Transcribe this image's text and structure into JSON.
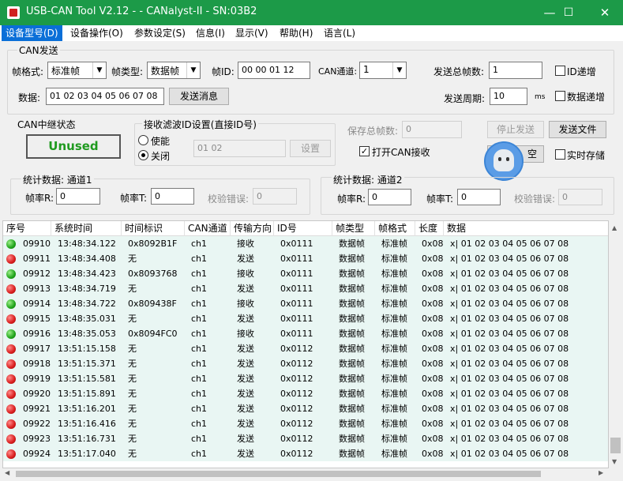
{
  "window": {
    "title": "USB-CAN Tool V2.12 -  - CANalyst-II - SN:03B2",
    "min_glyph": "—",
    "max_glyph": "☐",
    "close_glyph": "✕"
  },
  "menu": [
    "设备型号(D)",
    "设备操作(O)",
    "参数设定(S)",
    "信息(I)",
    "显示(V)",
    "帮助(H)",
    "语言(L)"
  ],
  "can_send": {
    "group_label": "CAN发送",
    "frame_format_label": "帧格式:",
    "frame_format_value": "标准帧",
    "frame_type_label": "帧类型:",
    "frame_type_value": "数据帧",
    "frame_id_label": "帧ID:",
    "frame_id_value": "00 00 01 12",
    "channel_label": "CAN通道:",
    "channel_value": "1",
    "total_frames_label": "发送总帧数:",
    "total_frames_value": "1",
    "id_increment_label": "ID递增",
    "data_label": "数据:",
    "data_value": "01 02 03 04 05 06 07 08",
    "send_button": "发送消息",
    "period_label": "发送周期:",
    "period_value": "10",
    "period_unit": "ms",
    "data_increment_label": "数据递增"
  },
  "relay": {
    "group_label": "CAN中继状态",
    "status": "Unused"
  },
  "filter": {
    "group_label": "接收滤波ID设置(直接ID号)",
    "enable_label": "使能",
    "disable_label": "关闭",
    "value": "01 02",
    "set_button": "设置"
  },
  "save": {
    "saved_frames_label": "保存总帧数:",
    "saved_frames_value": "0",
    "stop_send_button": "停止发送",
    "send_file_button": "发送文件",
    "open_receive_label": "打开CAN接收",
    "clear_button_partial": "空",
    "realtime_save_label": "实时存储"
  },
  "stats1": {
    "group_label": "统计数据: 通道1",
    "rate_r_label": "帧率R:",
    "rate_r_value": "0",
    "rate_t_label": "帧率T:",
    "rate_t_value": "0",
    "check_error_label": "校验错误:",
    "check_error_value": "0"
  },
  "stats2": {
    "group_label": "统计数据: 通道2",
    "rate_r_label": "帧率R:",
    "rate_r_value": "0",
    "rate_t_label": "帧率T:",
    "rate_t_value": "0",
    "check_error_label": "校验错误:",
    "check_error_value": "0"
  },
  "table": {
    "columns": [
      "序号",
      "系统时间",
      "时间标识",
      "CAN通道",
      "传输方向",
      "ID号",
      "帧类型",
      "帧格式",
      "长度",
      "数据"
    ],
    "rows": [
      {
        "status": "green",
        "seq": "09910",
        "sys_time": "13:48:34.122",
        "time_id": "0x8092B1F",
        "channel": "ch1",
        "direction": "接收",
        "id": "0x0111",
        "frame_type": "数据帧",
        "frame_format": "标准帧",
        "length": "0x08",
        "data": "x| 01 02 03 04 05 06 07 08"
      },
      {
        "status": "red",
        "seq": "09911",
        "sys_time": "13:48:34.408",
        "time_id": "无",
        "channel": "ch1",
        "direction": "发送",
        "id": "0x0111",
        "frame_type": "数据帧",
        "frame_format": "标准帧",
        "length": "0x08",
        "data": "x| 01 02 03 04 05 06 07 08"
      },
      {
        "status": "green",
        "seq": "09912",
        "sys_time": "13:48:34.423",
        "time_id": "0x8093768",
        "channel": "ch1",
        "direction": "接收",
        "id": "0x0111",
        "frame_type": "数据帧",
        "frame_format": "标准帧",
        "length": "0x08",
        "data": "x| 01 02 03 04 05 06 07 08"
      },
      {
        "status": "red",
        "seq": "09913",
        "sys_time": "13:48:34.719",
        "time_id": "无",
        "channel": "ch1",
        "direction": "发送",
        "id": "0x0111",
        "frame_type": "数据帧",
        "frame_format": "标准帧",
        "length": "0x08",
        "data": "x| 01 02 03 04 05 06 07 08"
      },
      {
        "status": "green",
        "seq": "09914",
        "sys_time": "13:48:34.722",
        "time_id": "0x809438F",
        "channel": "ch1",
        "direction": "接收",
        "id": "0x0111",
        "frame_type": "数据帧",
        "frame_format": "标准帧",
        "length": "0x08",
        "data": "x| 01 02 03 04 05 06 07 08"
      },
      {
        "status": "red",
        "seq": "09915",
        "sys_time": "13:48:35.031",
        "time_id": "无",
        "channel": "ch1",
        "direction": "发送",
        "id": "0x0111",
        "frame_type": "数据帧",
        "frame_format": "标准帧",
        "length": "0x08",
        "data": "x| 01 02 03 04 05 06 07 08"
      },
      {
        "status": "green",
        "seq": "09916",
        "sys_time": "13:48:35.053",
        "time_id": "0x8094FC0",
        "channel": "ch1",
        "direction": "接收",
        "id": "0x0111",
        "frame_type": "数据帧",
        "frame_format": "标准帧",
        "length": "0x08",
        "data": "x| 01 02 03 04 05 06 07 08"
      },
      {
        "status": "red",
        "seq": "09917",
        "sys_time": "13:51:15.158",
        "time_id": "无",
        "channel": "ch1",
        "direction": "发送",
        "id": "0x0112",
        "frame_type": "数据帧",
        "frame_format": "标准帧",
        "length": "0x08",
        "data": "x| 01 02 03 04 05 06 07 08"
      },
      {
        "status": "red",
        "seq": "09918",
        "sys_time": "13:51:15.371",
        "time_id": "无",
        "channel": "ch1",
        "direction": "发送",
        "id": "0x0112",
        "frame_type": "数据帧",
        "frame_format": "标准帧",
        "length": "0x08",
        "data": "x| 01 02 03 04 05 06 07 08"
      },
      {
        "status": "red",
        "seq": "09919",
        "sys_time": "13:51:15.581",
        "time_id": "无",
        "channel": "ch1",
        "direction": "发送",
        "id": "0x0112",
        "frame_type": "数据帧",
        "frame_format": "标准帧",
        "length": "0x08",
        "data": "x| 01 02 03 04 05 06 07 08"
      },
      {
        "status": "red",
        "seq": "09920",
        "sys_time": "13:51:15.891",
        "time_id": "无",
        "channel": "ch1",
        "direction": "发送",
        "id": "0x0112",
        "frame_type": "数据帧",
        "frame_format": "标准帧",
        "length": "0x08",
        "data": "x| 01 02 03 04 05 06 07 08"
      },
      {
        "status": "red",
        "seq": "09921",
        "sys_time": "13:51:16.201",
        "time_id": "无",
        "channel": "ch1",
        "direction": "发送",
        "id": "0x0112",
        "frame_type": "数据帧",
        "frame_format": "标准帧",
        "length": "0x08",
        "data": "x| 01 02 03 04 05 06 07 08"
      },
      {
        "status": "red",
        "seq": "09922",
        "sys_time": "13:51:16.416",
        "time_id": "无",
        "channel": "ch1",
        "direction": "发送",
        "id": "0x0112",
        "frame_type": "数据帧",
        "frame_format": "标准帧",
        "length": "0x08",
        "data": "x| 01 02 03 04 05 06 07 08"
      },
      {
        "status": "red",
        "seq": "09923",
        "sys_time": "13:51:16.731",
        "time_id": "无",
        "channel": "ch1",
        "direction": "发送",
        "id": "0x0112",
        "frame_type": "数据帧",
        "frame_format": "标准帧",
        "length": "0x08",
        "data": "x| 01 02 03 04 05 06 07 08"
      },
      {
        "status": "red",
        "seq": "09924",
        "sys_time": "13:51:17.040",
        "time_id": "无",
        "channel": "ch1",
        "direction": "发送",
        "id": "0x0112",
        "frame_type": "数据帧",
        "frame_format": "标准帧",
        "length": "0x08",
        "data": "x| 01 02 03 04 05 06 07 08"
      }
    ]
  }
}
